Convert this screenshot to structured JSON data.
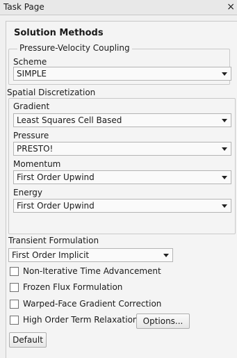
{
  "window": {
    "title": "Task Page",
    "close_glyph": "×"
  },
  "panel": {
    "heading": "Solution Methods",
    "pressure_velocity": {
      "legend": "Pressure-Velocity Coupling",
      "scheme_label": "Scheme",
      "scheme_value": "SIMPLE"
    },
    "spatial": {
      "legend": "Spatial Discretization",
      "gradient_label": "Gradient",
      "gradient_value": "Least Squares Cell Based",
      "pressure_label": "Pressure",
      "pressure_value": "PRESTO!",
      "momentum_label": "Momentum",
      "momentum_value": "First Order Upwind",
      "energy_label": "Energy",
      "energy_value": "First Order Upwind"
    },
    "transient": {
      "label": "Transient Formulation",
      "value": "First Order Implicit"
    },
    "options": [
      {
        "label": "Non-Iterative Time Advancement",
        "checked": false
      },
      {
        "label": "Frozen Flux Formulation",
        "checked": false
      },
      {
        "label": "Warped-Face Gradient Correction",
        "checked": false
      },
      {
        "label": "High Order Term Relaxation",
        "checked": false
      }
    ],
    "options_button": "Options...",
    "default_button": "Default"
  }
}
